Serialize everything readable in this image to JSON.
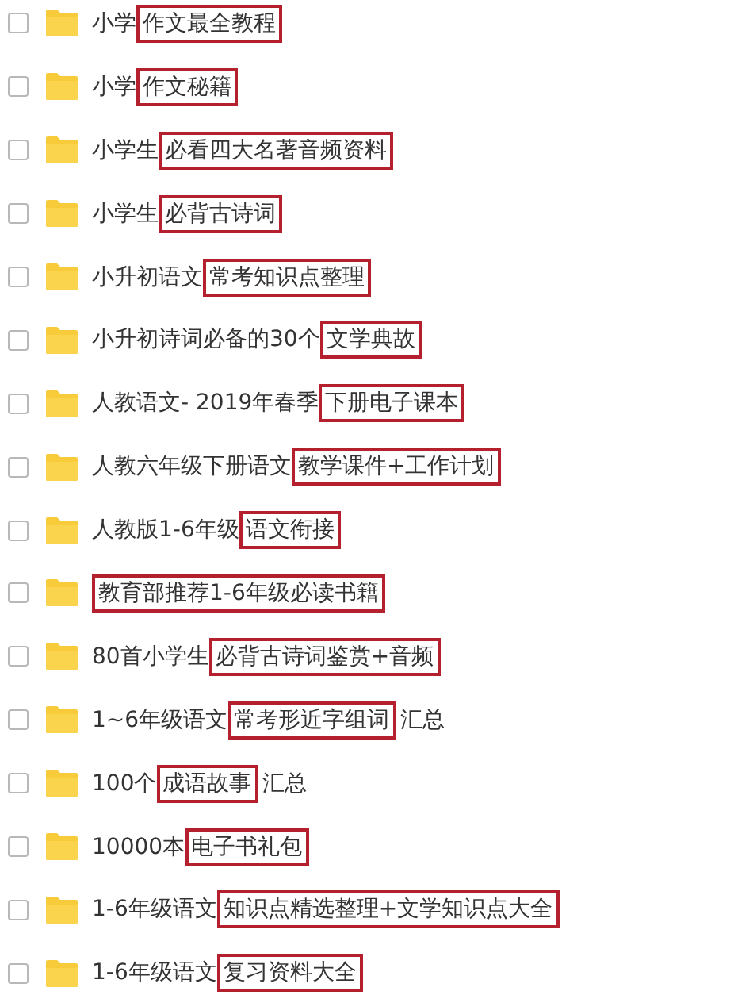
{
  "rows": [
    {
      "checked": false,
      "prefix": "小学",
      "highlight": "作文最全教程"
    },
    {
      "checked": false,
      "prefix": "小学",
      "highlight": "作文秘籍"
    },
    {
      "checked": false,
      "prefix": "小学生",
      "highlight": "必看四大名著音频资料"
    },
    {
      "checked": false,
      "prefix": "小学生",
      "highlight": "必背古诗词"
    },
    {
      "checked": false,
      "prefix": "小升初语文",
      "highlight": "常考知识点整理"
    },
    {
      "checked": false,
      "prefix": "小升初诗词必备的30个",
      "highlight": "文学典故"
    },
    {
      "checked": false,
      "prefix": "人教语文- 2019年春季",
      "highlight": "下册电子课本"
    },
    {
      "checked": false,
      "prefix": "人教六年级下册语文",
      "highlight": "教学课件+工作计划"
    },
    {
      "checked": false,
      "prefix": "人教版1-6年级",
      "highlight": "语文衔接"
    },
    {
      "checked": false,
      "highlight": "教育部推荐1-6年级必读书籍"
    },
    {
      "checked": false,
      "prefix": "80首小学生",
      "highlight": "必背古诗词鉴赏+音频"
    },
    {
      "checked": false,
      "prefix": "1~6年级语文",
      "highlight": "常考形近字组词",
      "suffix": "汇总"
    },
    {
      "checked": false,
      "prefix": "100个",
      "highlight": "成语故事",
      "suffix": "汇总"
    },
    {
      "checked": false,
      "prefix": "10000本",
      "highlight": "电子书礼包"
    },
    {
      "checked": false,
      "prefix": "1-6年级语文",
      "highlight": "知识点精选整理+文学知识点大全"
    },
    {
      "checked": false,
      "prefix": "1-6年级语文",
      "highlight": "复习资料大全"
    }
  ]
}
